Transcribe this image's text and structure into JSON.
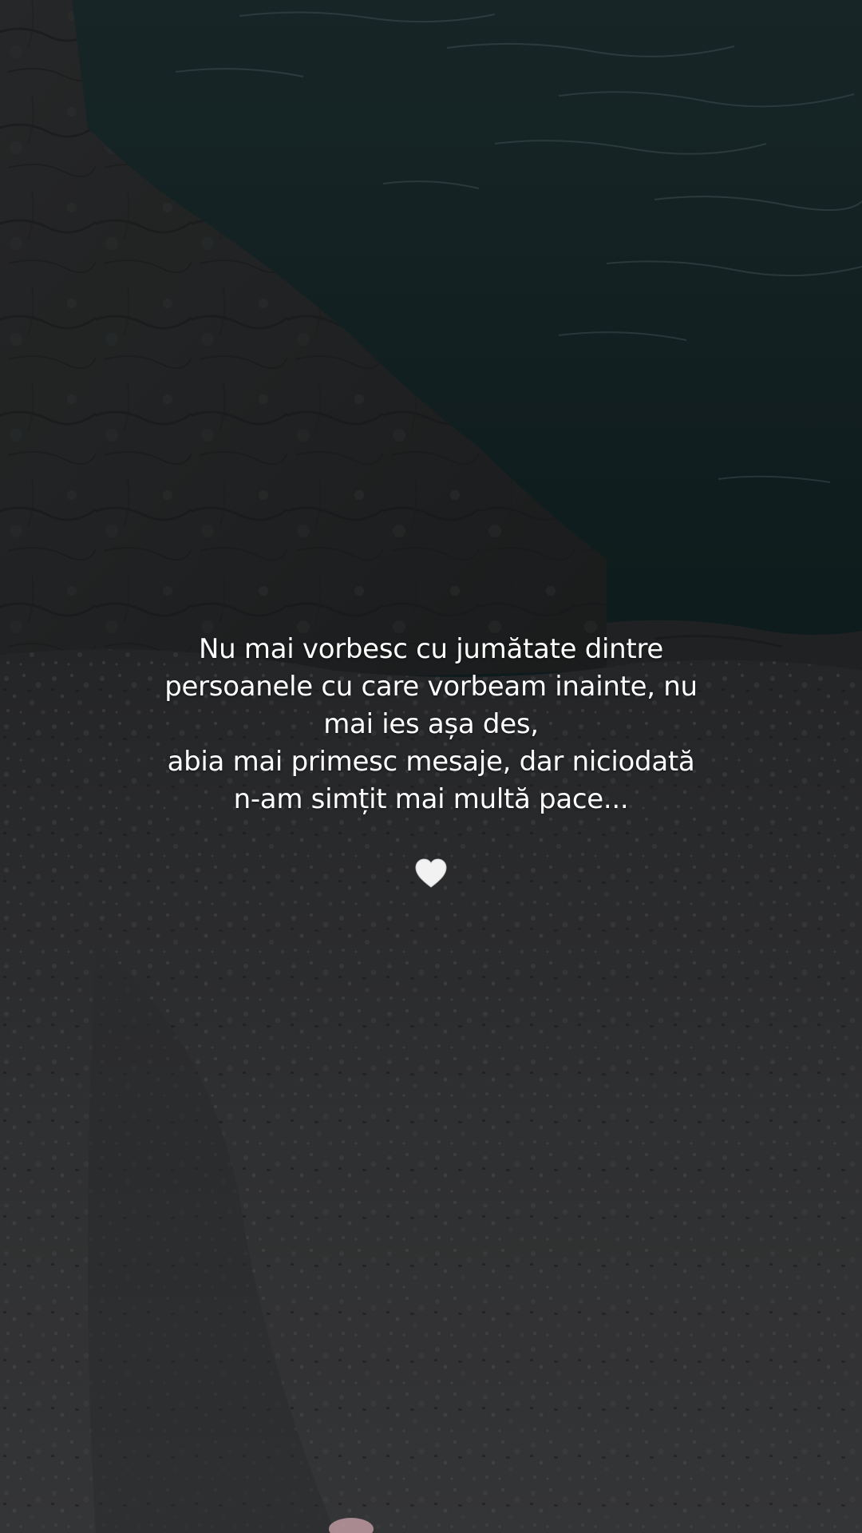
{
  "caption": {
    "lines": [
      "Nu mai vorbesc cu jumătate dintre",
      "persoanele cu care vorbeam inainte, nu",
      "mai ies așa des,",
      "abia mai primesc mesaje, dar niciodată",
      "n-am simțit mai multă pace..."
    ]
  },
  "emoji": {
    "icon": "white-heart-icon",
    "color": "#f2f2f2"
  },
  "colors": {
    "water": "#0f1c1d",
    "rock": "#262829",
    "gravel": "#3a3b3c",
    "text": "#ffffff"
  }
}
